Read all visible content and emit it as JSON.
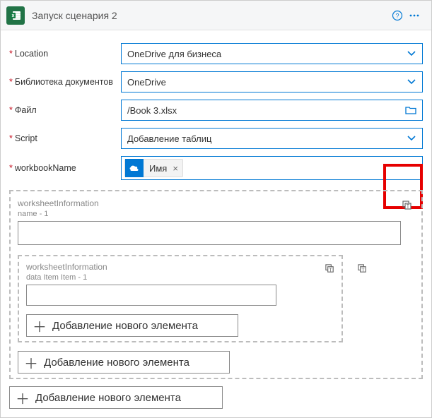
{
  "header": {
    "title": "Запуск сценария 2"
  },
  "fields": {
    "location": {
      "label": "Location",
      "value": "OneDrive для бизнеса"
    },
    "library": {
      "label": "Библиотека документов",
      "value": "OneDrive"
    },
    "file": {
      "label": "Файл",
      "value": "/Book 3.xlsx"
    },
    "script": {
      "label": "Script",
      "value": "Добавление таблиц"
    },
    "workbook": {
      "label": "workbookName",
      "token": "Имя"
    }
  },
  "array": {
    "labelTop": "worksheetInformation",
    "labelTopSub": "name - 1",
    "inner": {
      "label": "worksheetInformation",
      "labelSub": "data Item Item - 1"
    },
    "addLabel": "Добавление нового элемента"
  }
}
